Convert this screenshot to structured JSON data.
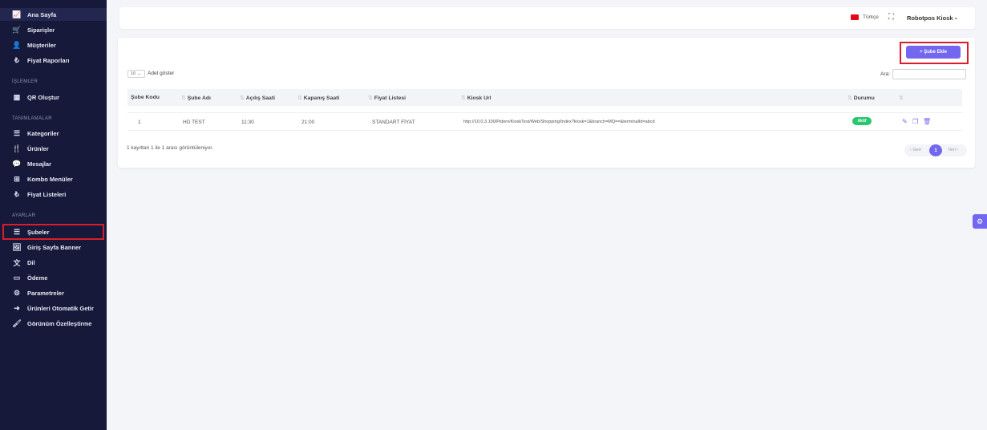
{
  "sidebar": {
    "items": [
      {
        "label": "Ana Sayfa",
        "icon": "chart-line-icon",
        "glyph": "📈"
      },
      {
        "label": "Siparişler",
        "icon": "cart-icon",
        "glyph": "🛒"
      },
      {
        "label": "Müşteriler",
        "icon": "user-icon",
        "glyph": "👤"
      },
      {
        "label": "Fiyat Raporları",
        "icon": "lira-icon",
        "glyph": "₺"
      },
      {
        "label": "QR Oluştur",
        "icon": "qr-icon",
        "glyph": "▦"
      },
      {
        "label": "Kategoriler",
        "icon": "list-icon",
        "glyph": "☰"
      },
      {
        "label": "Ürünler",
        "icon": "utensils-icon",
        "glyph": "🍴"
      },
      {
        "label": "Mesajlar",
        "icon": "chat-icon",
        "glyph": "💬"
      },
      {
        "label": "Kombo Menüler",
        "icon": "combo-icon",
        "glyph": "⊞"
      },
      {
        "label": "Fiyat Listeleri",
        "icon": "lira-icon",
        "glyph": "₺"
      },
      {
        "label": "Şubeler",
        "icon": "list-icon",
        "glyph": "☰"
      },
      {
        "label": "Giriş Sayfa Banner",
        "icon": "image-icon",
        "glyph": "🖼"
      },
      {
        "label": "Dil",
        "icon": "language-icon",
        "glyph": "文"
      },
      {
        "label": "Ödeme",
        "icon": "credit-card-icon",
        "glyph": "▭"
      },
      {
        "label": "Parametreler",
        "icon": "gears-icon",
        "glyph": "⚙"
      },
      {
        "label": "Ürünleri Otomatik Getir",
        "icon": "sign-in-icon",
        "glyph": "➜"
      },
      {
        "label": "Görünüm Özelleştirme",
        "icon": "brush-icon",
        "glyph": "🖌"
      }
    ],
    "sections": [
      "İŞLEMLER",
      "TANIMLAMALAR",
      "AYARLAR"
    ]
  },
  "topbar": {
    "language": "Türkçe",
    "user": "Robotpos Kiosk",
    "flag_color": "#e30a17"
  },
  "toolbar": {
    "add_label": "+ Şube Ekle",
    "page_size": "10",
    "show_label": "Adet göster",
    "search_label": "Ara:"
  },
  "table": {
    "columns": [
      "Şube Kodu",
      "Şube Adı",
      "Açılış Saati",
      "Kapanış Saati",
      "Fiyat Listesi",
      "Kiosk Url",
      "Durumu"
    ],
    "rows": [
      {
        "code": "1",
        "name": "HD TEST",
        "open": "11:30",
        "close": "21:00",
        "price_list": "STANDART FİYAT",
        "kiosk_url": "http://10.0.3.100/Pidern/KioskTest/Web/Shopping/Index?kiosk=1&branch=MQ==&terminalId=abcd",
        "status": "Aktif"
      }
    ]
  },
  "footer": {
    "info": "1 kayıttan 1 ile 1 arası görüntüleniyor.",
    "prev": "‹ Geri",
    "page": "1",
    "next": "İleri ›"
  },
  "colors": {
    "accent": "#7367f0",
    "sidebar_bg": "#16193a",
    "success": "#28c76f",
    "highlight": "#d81e2a"
  }
}
